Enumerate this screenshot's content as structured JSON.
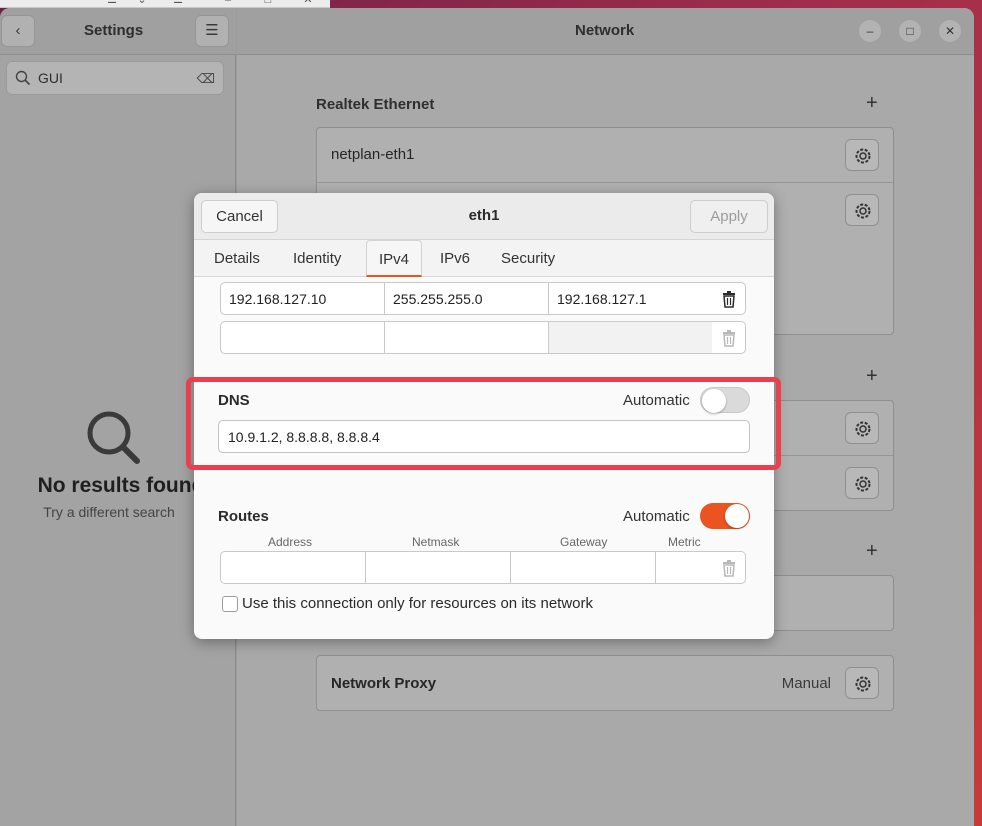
{
  "settings": {
    "title": "Settings",
    "search_value": "GUI",
    "no_results_title": "No results found",
    "no_results_sub": "Try a different search"
  },
  "network": {
    "title": "Network",
    "sections": {
      "realtek": "Realtek Ethernet",
      "connection_1": "netplan-eth1",
      "proxy": "Network Proxy",
      "proxy_value": "Manual"
    }
  },
  "dialog": {
    "title": "eth1",
    "cancel": "Cancel",
    "apply": "Apply",
    "tabs": [
      "Details",
      "Identity",
      "IPv4",
      "IPv6",
      "Security"
    ],
    "active_tab": "IPv4",
    "addresses": [
      {
        "address": "192.168.127.10",
        "netmask": "255.255.255.0",
        "gateway": "192.168.127.1"
      },
      {
        "address": "",
        "netmask": "",
        "gateway": ""
      }
    ],
    "dns": {
      "label": "DNS",
      "automatic_label": "Automatic",
      "automatic": false,
      "value": "10.9.1.2, 8.8.8.8, 8.8.8.4"
    },
    "routes": {
      "label": "Routes",
      "automatic_label": "Automatic",
      "automatic": true,
      "columns": [
        "Address",
        "Netmask",
        "Gateway",
        "Metric"
      ]
    },
    "only_resources_label": "Use this connection only for resources on its network"
  },
  "colors": {
    "accent": "#e95420",
    "highlight": "#e8404e"
  }
}
